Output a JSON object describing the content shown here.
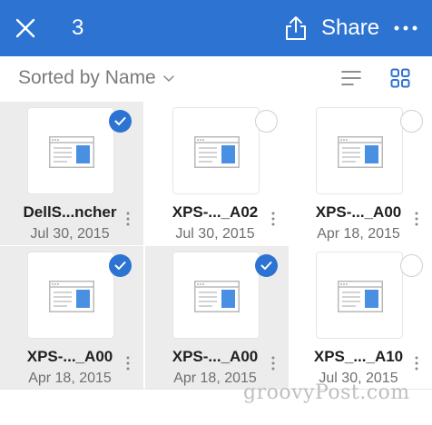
{
  "header": {
    "selected_count": "3",
    "share_label": "Share",
    "close_icon": "close-icon",
    "share_icon": "share-icon",
    "more_icon": "more-icon"
  },
  "sort": {
    "label": "Sorted by Name",
    "list_view_icon": "list-view-icon",
    "grid_view_icon": "grid-view-icon"
  },
  "files": [
    {
      "name": "DellS...ncher",
      "date": "Jul 30, 2015",
      "selected": true
    },
    {
      "name": "XPS-..._A02",
      "date": "Jul 30, 2015",
      "selected": false
    },
    {
      "name": "XPS-..._A00",
      "date": "Apr 18, 2015",
      "selected": false
    },
    {
      "name": "XPS-..._A00",
      "date": "Apr 18, 2015",
      "selected": true
    },
    {
      "name": "XPS-..._A00",
      "date": "Apr 18, 2015",
      "selected": true
    },
    {
      "name": "XPS_..._A10",
      "date": "Jul 30, 2015",
      "selected": false
    }
  ],
  "watermark": "groovyPost.com",
  "colors": {
    "accent": "#2d73d2",
    "selected_tile": "#ececec",
    "doc_preview": "#4a90e2"
  }
}
